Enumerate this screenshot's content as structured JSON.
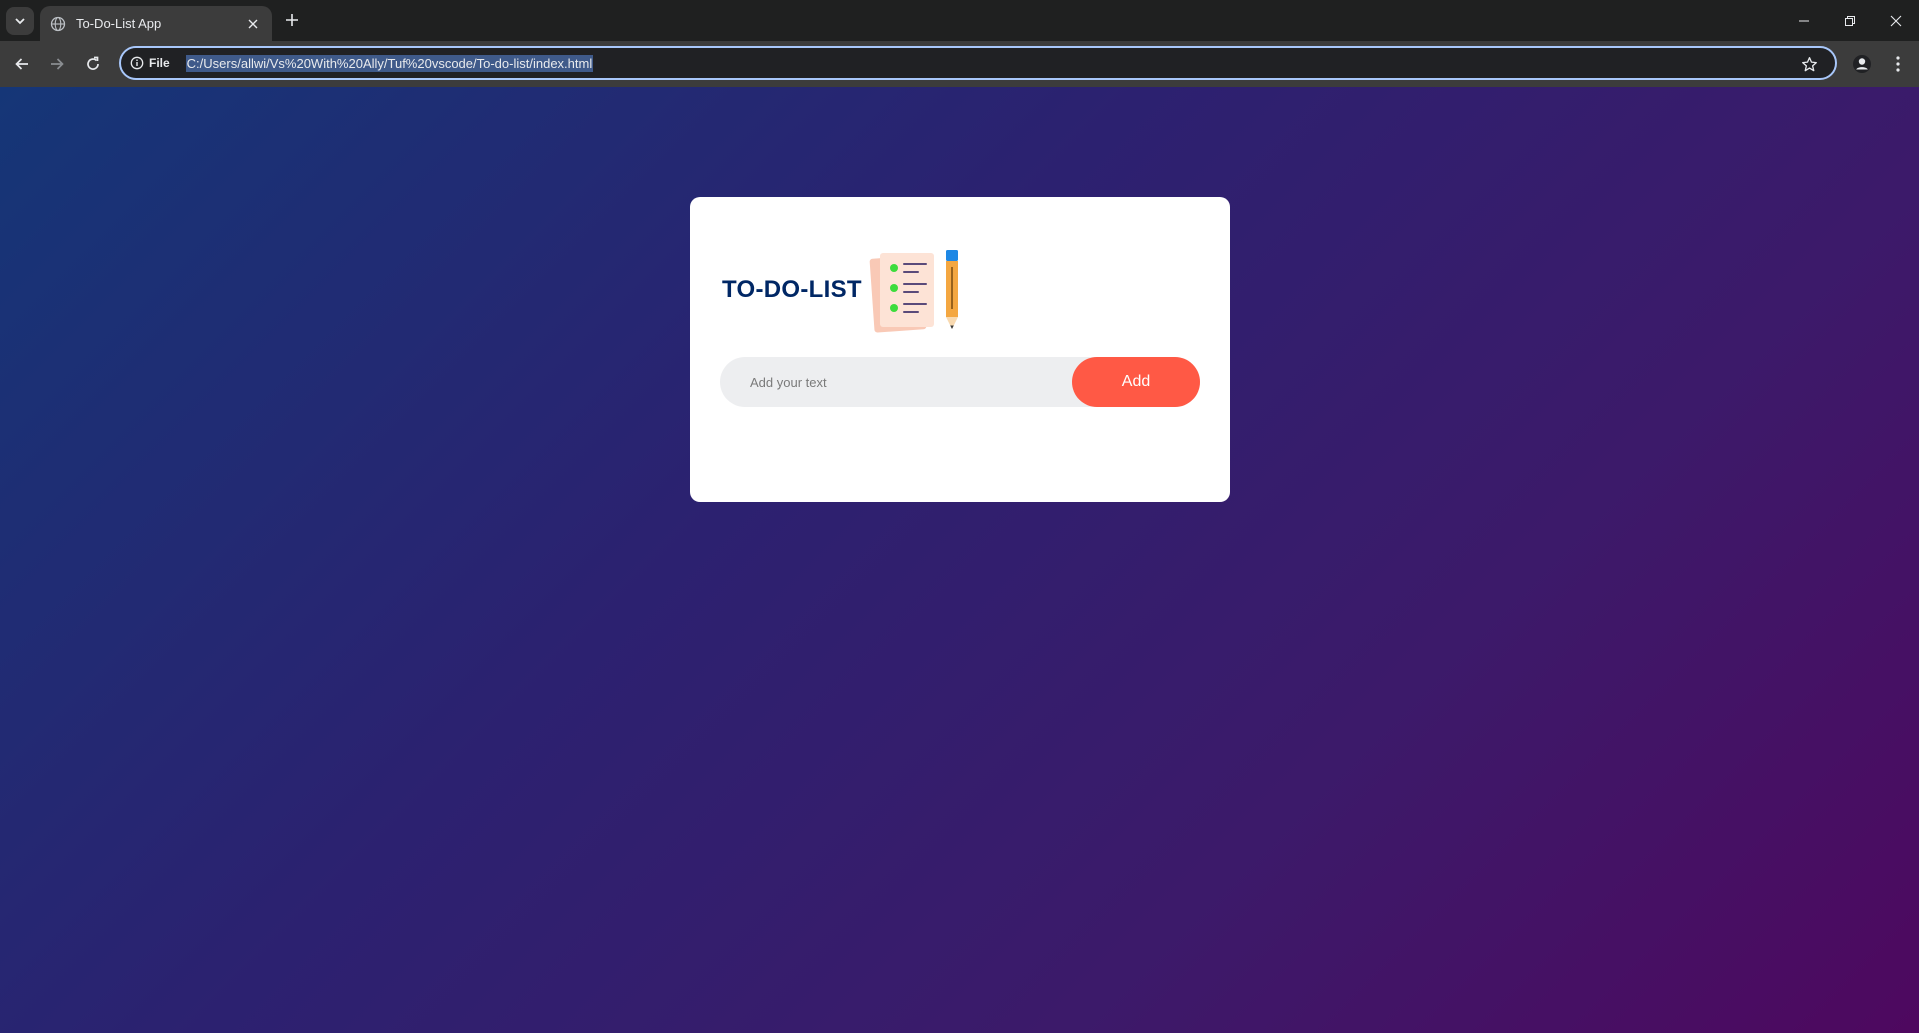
{
  "browser": {
    "tab_title": "To-Do-List App",
    "info_chip_label": "File",
    "url": "C:/Users/allwi/Vs%20With%20Ally/Tuf%20vscode/To-do-list/index.html",
    "icons": {
      "tab_search": "chevron-down-icon",
      "favicon": "globe-icon",
      "tab_close": "close-icon",
      "new_tab": "plus-icon",
      "back": "back-arrow-icon",
      "forward": "forward-arrow-icon",
      "reload": "reload-icon",
      "info": "info-icon",
      "bookmark": "star-icon",
      "profile": "profile-icon",
      "menu": "kebab-menu-icon",
      "minimize": "minimize-icon",
      "restore": "restore-icon",
      "close_window": "close-icon"
    }
  },
  "app": {
    "heading": "TO-DO-LIST",
    "illustration_icon": "checklist-pencil-icon",
    "input_placeholder": "Add your text",
    "input_value": "",
    "add_button_label": "Add",
    "tasks": []
  },
  "colors": {
    "gradient_start": "#153677",
    "gradient_end": "#4e085f",
    "heading": "#002765",
    "add_button": "#ff5945",
    "input_background": "#edeef0"
  }
}
